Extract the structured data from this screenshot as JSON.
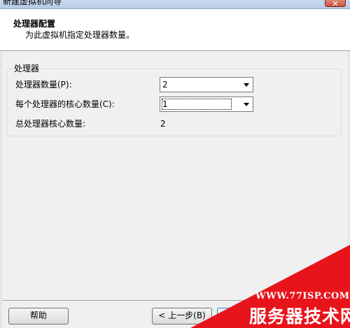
{
  "window": {
    "title": "新建虚拟机向导",
    "close_glyph": "✕"
  },
  "header": {
    "title": "处理器配置",
    "subtitle": "为此虚拟机指定处理器数量。"
  },
  "processor_group": {
    "title": "处理器",
    "processor_count": {
      "label": "处理器数量(P):",
      "value": "2"
    },
    "cores_per_processor": {
      "label": "每个处理器的核心数量(C):",
      "value": "1"
    },
    "total_cores": {
      "label": "总处理器核心数量:",
      "value": "2"
    }
  },
  "buttons": {
    "help": "帮助",
    "back": "< 上一步(B)"
  },
  "watermark": {
    "url": "WWW.77ISP.COM",
    "name": "服务器技术网",
    "color": "#e8141c"
  },
  "colors": {
    "dialog_bg": "#f0f0f0",
    "header_bg": "#ffffff"
  }
}
